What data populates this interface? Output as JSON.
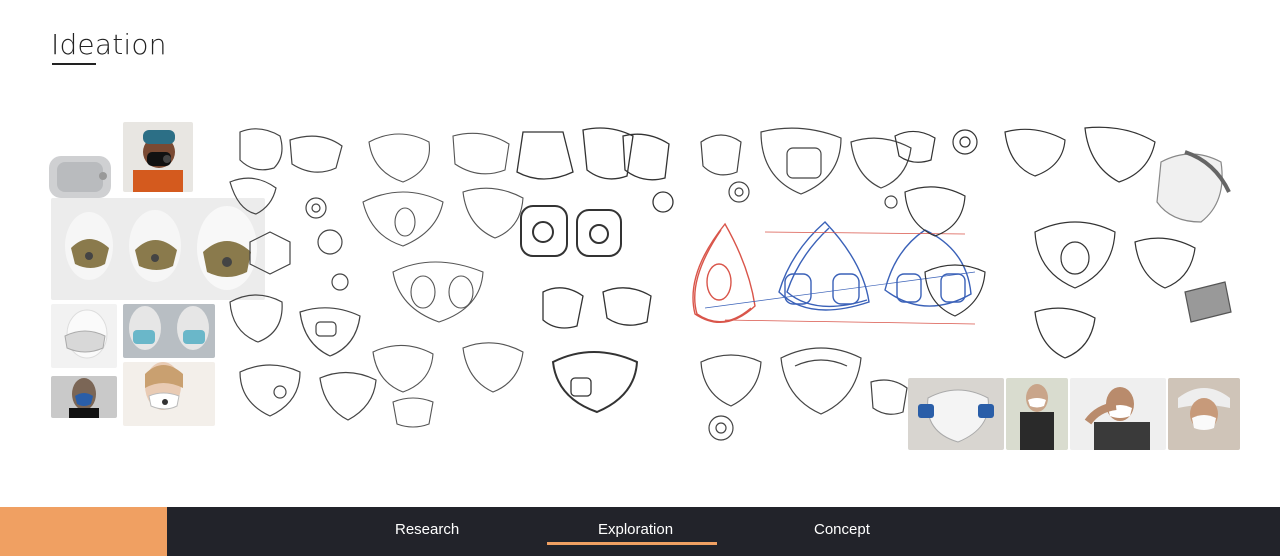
{
  "page": {
    "title": "Ideation"
  },
  "nav": {
    "accent_color": "#f0a062",
    "bar_color": "#22232a",
    "items": [
      {
        "label": "Research"
      },
      {
        "label": "Exploration",
        "active": true
      },
      {
        "label": "Concept"
      }
    ]
  }
}
